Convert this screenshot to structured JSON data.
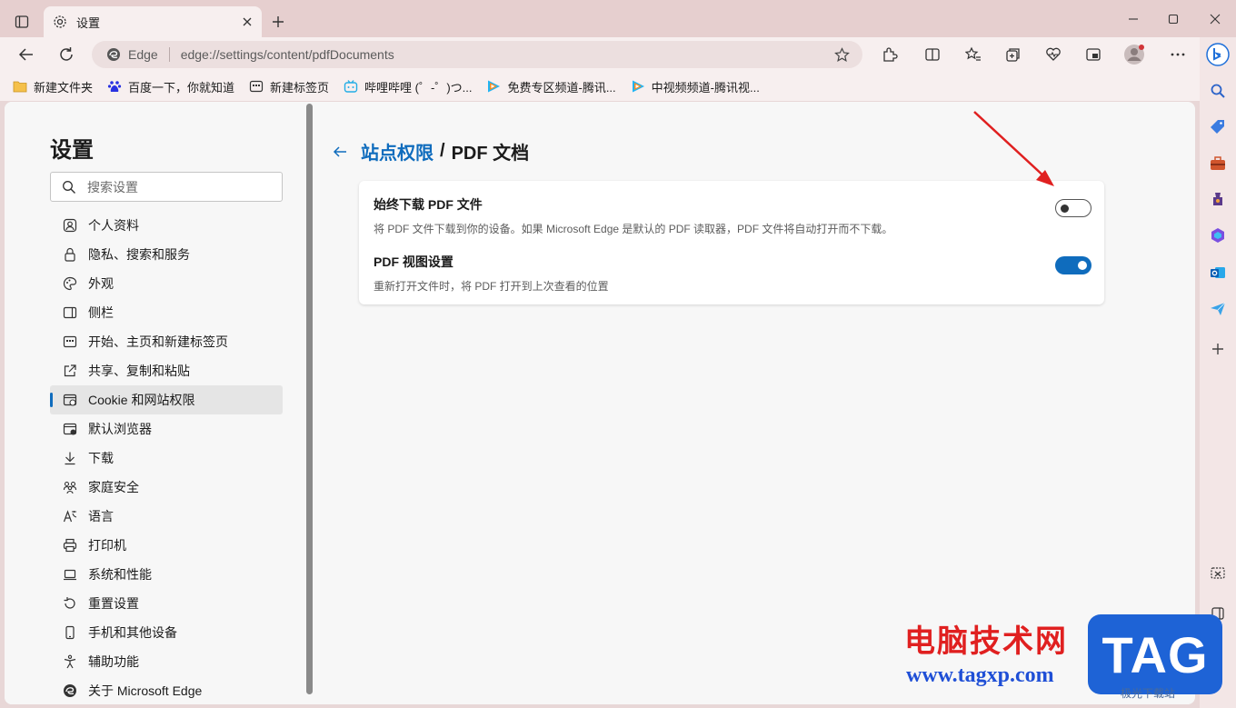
{
  "window": {
    "tab_title": "设置"
  },
  "address_bar": {
    "site_chip": "Edge",
    "url": "edge://settings/content/pdfDocuments"
  },
  "bookmarks": [
    {
      "label": "新建文件夹",
      "icon": "folder-icon"
    },
    {
      "label": "百度一下，你就知道",
      "icon": "baidu-icon"
    },
    {
      "label": "新建标签页",
      "icon": "newtab-icon"
    },
    {
      "label": "哔哩哔哩 (゜-゜)つ...",
      "icon": "bilibili-icon"
    },
    {
      "label": "免费专区频道-腾讯...",
      "icon": "tencent-video-icon"
    },
    {
      "label": "中视频频道-腾讯视...",
      "icon": "tencent-video-icon"
    }
  ],
  "sidebar": {
    "title": "设置",
    "search_placeholder": "搜索设置",
    "items": [
      {
        "label": "个人资料",
        "icon": "profile-icon"
      },
      {
        "label": "隐私、搜索和服务",
        "icon": "lock-icon"
      },
      {
        "label": "外观",
        "icon": "palette-icon"
      },
      {
        "label": "侧栏",
        "icon": "sidebar-icon"
      },
      {
        "label": "开始、主页和新建标签页",
        "icon": "home-icon"
      },
      {
        "label": "共享、复制和粘贴",
        "icon": "share-icon"
      },
      {
        "label": "Cookie 和网站权限",
        "icon": "cookie-icon",
        "active": true
      },
      {
        "label": "默认浏览器",
        "icon": "browser-icon"
      },
      {
        "label": "下载",
        "icon": "download-icon"
      },
      {
        "label": "家庭安全",
        "icon": "family-icon"
      },
      {
        "label": "语言",
        "icon": "language-icon"
      },
      {
        "label": "打印机",
        "icon": "printer-icon"
      },
      {
        "label": "系统和性能",
        "icon": "laptop-icon"
      },
      {
        "label": "重置设置",
        "icon": "reset-icon"
      },
      {
        "label": "手机和其他设备",
        "icon": "phone-icon"
      },
      {
        "label": "辅助功能",
        "icon": "accessibility-icon"
      },
      {
        "label": "关于 Microsoft Edge",
        "icon": "edge-icon"
      }
    ]
  },
  "main": {
    "breadcrumb_parent": "站点权限",
    "breadcrumb_sep": "/",
    "breadcrumb_current": "PDF 文档",
    "settings": [
      {
        "title": "始终下载 PDF 文件",
        "description": "将 PDF 文件下载到你的设备。如果 Microsoft Edge 是默认的 PDF 读取器，PDF 文件将自动打开而不下载。",
        "enabled": false
      },
      {
        "title": "PDF 视图设置",
        "description": "重新打开文件时，将 PDF 打开到上次查看的位置",
        "enabled": true
      }
    ]
  },
  "watermark": {
    "site_name": "电脑技术网",
    "url": "www.tagxp.com",
    "badge": "TAG",
    "small": "极光下载站"
  },
  "colors": {
    "accent": "#0f6cbd",
    "annotation_arrow": "#e02020"
  }
}
